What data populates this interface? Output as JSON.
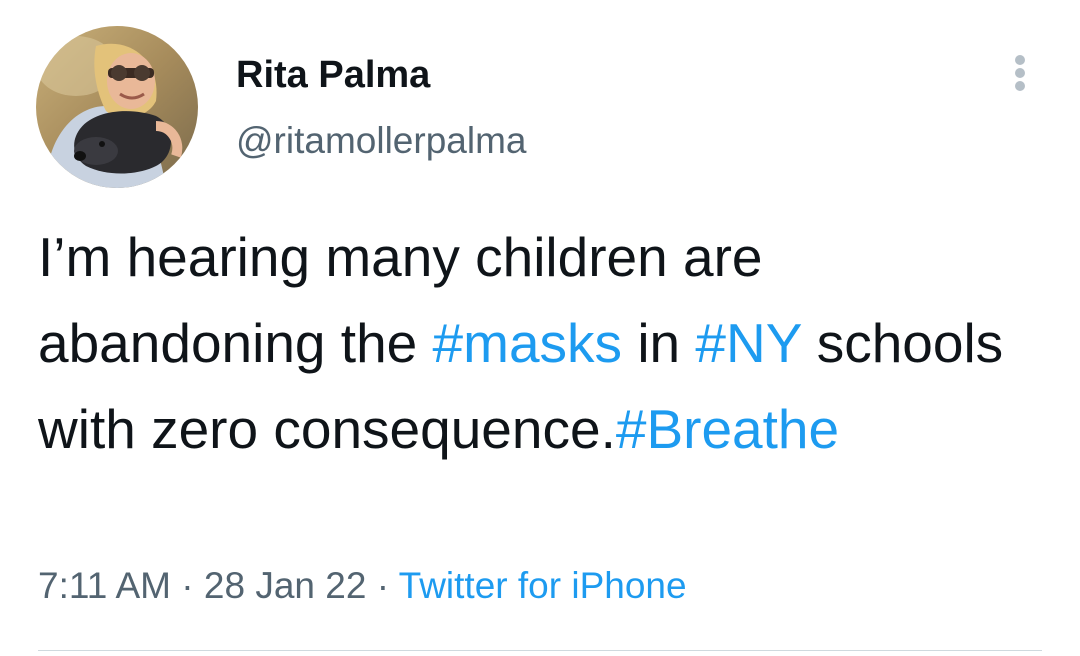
{
  "author": {
    "display_name": "Rita Palma",
    "handle": "@ritamollerpalma",
    "avatar": "profile-photo-woman-with-dog"
  },
  "tweet": {
    "segments": [
      {
        "text": "I’m hearing many children are abandoning the ",
        "type": "text"
      },
      {
        "text": "#masks",
        "type": "hashtag"
      },
      {
        "text": " in ",
        "type": "text"
      },
      {
        "text": "#NY",
        "type": "hashtag"
      },
      {
        "text": " schools with zero consequence.",
        "type": "text"
      },
      {
        "text": "#Breathe",
        "type": "hashtag"
      }
    ]
  },
  "meta": {
    "time": "7:11 AM",
    "separator": " · ",
    "date": "28 Jan 22",
    "source": "Twitter for iPhone"
  },
  "icons": {
    "more": "more-options-icon"
  },
  "colors": {
    "text": "#0f1419",
    "secondary": "#536471",
    "link": "#1d9bf0",
    "divider": "#cfd9de"
  }
}
